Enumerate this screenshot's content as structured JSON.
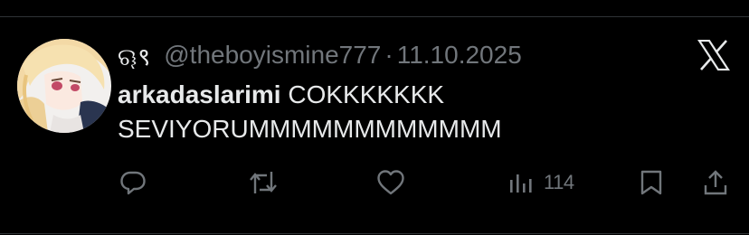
{
  "tweet": {
    "display_name": "ୠ९",
    "handle": "@theboyismine777",
    "separator": "·",
    "timestamp": "11.10.2025",
    "mention": "arkadaslarimi",
    "text": " COKKKKKKK SEVIYORUMMMMMMMMMMMM"
  },
  "actions": {
    "reply": {
      "icon": "reply-icon"
    },
    "retweet": {
      "icon": "retweet-icon"
    },
    "like": {
      "icon": "heart-icon"
    },
    "views": {
      "icon": "views-bar-chart-icon",
      "count": "114"
    },
    "bookmark": {
      "icon": "bookmark-icon"
    },
    "share": {
      "icon": "share-icon"
    }
  },
  "brand": {
    "logo": "x-logo-icon"
  },
  "colors": {
    "background": "#000000",
    "text": "#e7e9ea",
    "muted": "#71767b",
    "divider": "#2f3336"
  }
}
